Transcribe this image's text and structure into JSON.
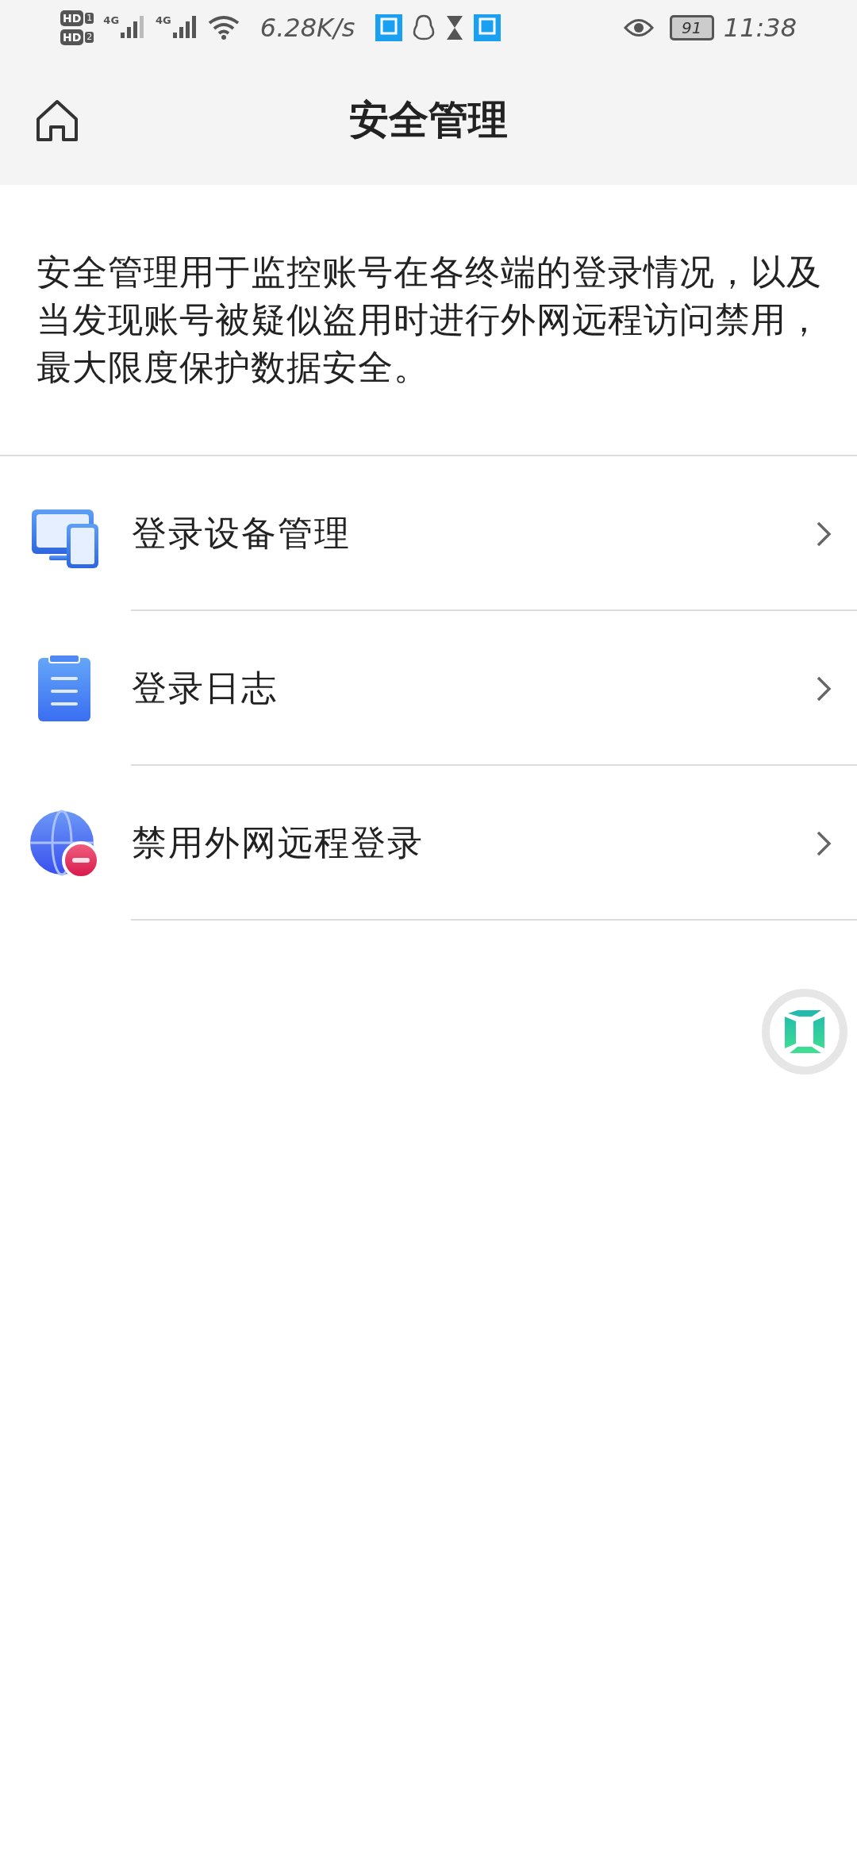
{
  "status_bar": {
    "sims": [
      {
        "label": "HD",
        "slot": "1"
      },
      {
        "label": "HD",
        "slot": "2"
      }
    ],
    "networks": [
      {
        "label": "4G"
      },
      {
        "label": "4G"
      }
    ],
    "speed": "6.28K/s",
    "battery": "91",
    "time": "11:38"
  },
  "header": {
    "title": "安全管理"
  },
  "description": "安全管理用于监控账号在各终端的登录情况，以及当发现账号被疑似盗用时进行外网远程访问禁用，最大限度保护数据安全。",
  "menu": [
    {
      "kind": "devices",
      "label": "登录设备管理"
    },
    {
      "kind": "log",
      "label": "登录日志"
    },
    {
      "kind": "block",
      "label": "禁用外网远程登录"
    }
  ]
}
